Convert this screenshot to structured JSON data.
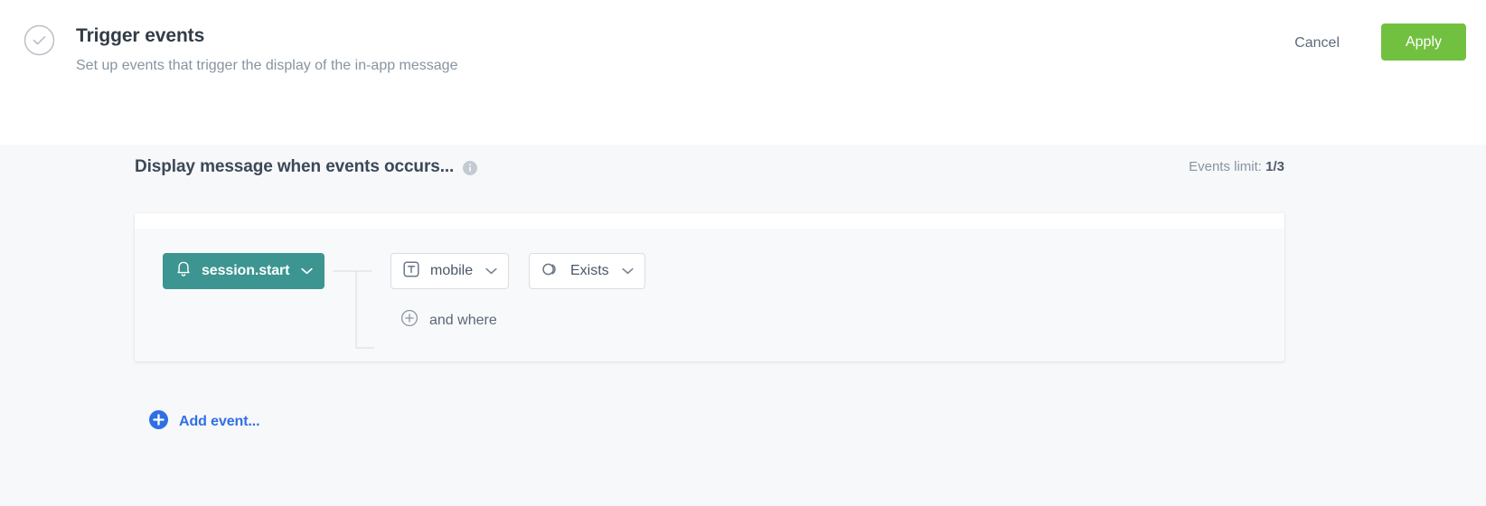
{
  "header": {
    "title": "Trigger events",
    "subtitle": "Set up events that trigger the display of the in-app message",
    "status_icon": "check-circle-icon",
    "cancel_label": "Cancel",
    "apply_label": "Apply",
    "apply_color": "#72c040"
  },
  "section": {
    "title": "Display message when events occurs...",
    "info_icon": "info-icon",
    "events_limit_label": "Events limit:",
    "events_limit_value": "1/3"
  },
  "card": {
    "event_chip": {
      "icon": "bell-icon",
      "label": "session.start",
      "chevron": "chevron-down-icon",
      "color": "#3c9590"
    },
    "condition": {
      "attribute": {
        "icon": "text-type-icon",
        "label": "mobile",
        "chevron": "chevron-down-icon"
      },
      "operator": {
        "icon": "exists-icon",
        "label": "Exists",
        "chevron": "chevron-down-icon"
      }
    },
    "and_where": {
      "icon": "plus-circle-outline-icon",
      "label": "and where"
    }
  },
  "footer": {
    "add_event": {
      "icon": "plus-circle-filled-icon",
      "label": "Add event...",
      "color": "#2f6fe4"
    }
  }
}
